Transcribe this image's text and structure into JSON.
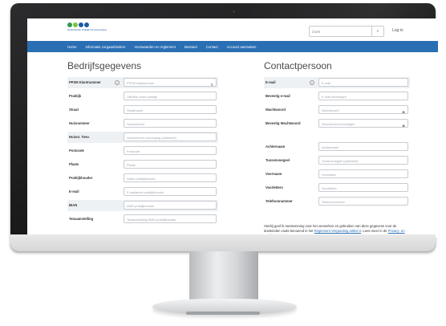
{
  "header": {
    "logo_label": "Nederlandse Praktijk Kernvereniging",
    "search_placeholder": "Zoek",
    "search_icon": "magnifier",
    "login_label": "Log in"
  },
  "nav": [
    "Home",
    "Informatie zorgaanbieders",
    "Voorwaarden en reglement",
    "Bestand",
    "Contact",
    "Account aanmaken"
  ],
  "company": {
    "title": "Bedrijfsgegevens",
    "fields": [
      {
        "label": "PPZM Klantnummer",
        "placeholder": "PPZM klantnummer",
        "info": true,
        "control": "stepper"
      },
      {
        "label": "Praktijk",
        "placeholder": "Officiële naam praktijk"
      },
      {
        "label": "Straat",
        "placeholder": "Straatnaam"
      },
      {
        "label": "Huisnummer",
        "placeholder": "Huisnummer"
      },
      {
        "label": "Huisnr. Toev.",
        "placeholder": "Huisnummer toevoeging (optioneel)"
      },
      {
        "label": "Postcode",
        "placeholder": "Postcode"
      },
      {
        "label": "Plaats",
        "placeholder": "Plaats"
      },
      {
        "label": "Praktijkhouder",
        "placeholder": "Naam praktijkhouder"
      },
      {
        "label": "E-mail",
        "placeholder": "E-mailadres praktijkhouder"
      },
      {
        "label": "IBAN",
        "placeholder": "IBAN praktijkhouder"
      },
      {
        "label": "Tenaamstelling",
        "placeholder": "Tenaamstelling IBAN praktijkhouder"
      }
    ]
  },
  "contact": {
    "title": "Contactpersoon",
    "fields": [
      {
        "label": "E-mail",
        "placeholder": "E-mail",
        "info": true
      },
      {
        "label": "Bevestig e-mail",
        "placeholder": "E-mail bevestigen"
      },
      {
        "label": "Wachtwoord",
        "placeholder": "Wachtwoord",
        "control": "eye"
      },
      {
        "label": "Bevestig Wachtwoord",
        "placeholder": "Wachtwoord bevestigen",
        "control": "eye"
      },
      {
        "label": "Achternaam",
        "placeholder": "Achternaam"
      },
      {
        "label": "Tussenvoegsel",
        "placeholder": "Tussenvoegsel (optioneel)"
      },
      {
        "label": "Voornaam",
        "placeholder": "Voornaam"
      },
      {
        "label": "Voorletters",
        "placeholder": "Voorletters"
      },
      {
        "label": "Telefoonnummer",
        "placeholder": "Telefoonnummer"
      }
    ],
    "consent_text_1": "Hierbij geef ik toestemming voor het verwerken en gebruiken van deze gegevens voor de doeleinden zoals benoemd in het ",
    "consent_link_1": "Reglement Vergoeding artikel 2",
    "consent_text_2": ". Lees meer in de ",
    "consent_link_2": "Privacy- en cookieverklaring",
    "consent_text_3": "."
  },
  "colors": {
    "nav_bg": "#2a6fb4",
    "logo_dots": [
      "#2f9b4e",
      "#7cc242",
      "#1a5aa5",
      "#1a5aa5"
    ]
  }
}
